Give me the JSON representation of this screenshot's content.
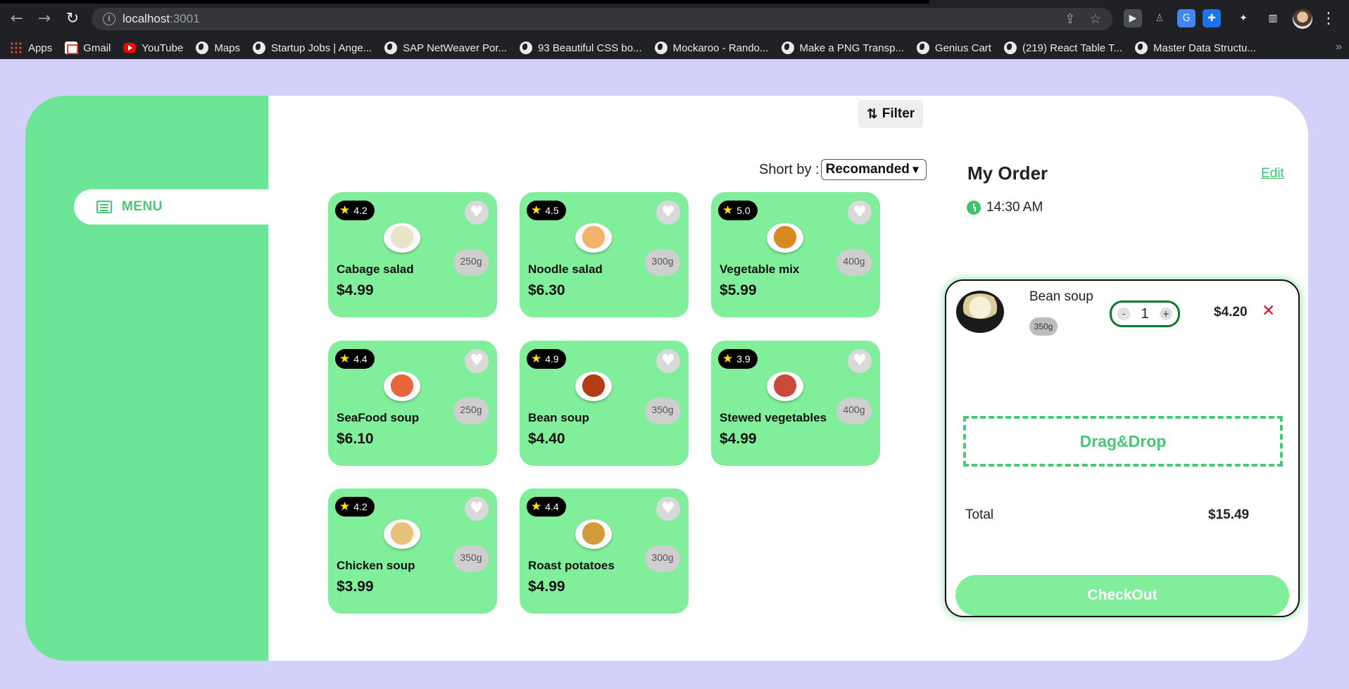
{
  "browser": {
    "url_host": "localhost",
    "url_port": ":3001",
    "bookmarks": [
      {
        "label": "Apps",
        "icon": "apps-grid-icon"
      },
      {
        "label": "Gmail",
        "icon": "gmail-icon"
      },
      {
        "label": "YouTube",
        "icon": "youtube-icon"
      },
      {
        "label": "Maps",
        "icon": "globe-icon"
      },
      {
        "label": "Startup Jobs | Ange...",
        "icon": "globe-icon"
      },
      {
        "label": "SAP NetWeaver Por...",
        "icon": "globe-icon"
      },
      {
        "label": "93 Beautiful CSS bo...",
        "icon": "globe-icon"
      },
      {
        "label": "Mockaroo - Rando...",
        "icon": "globe-icon"
      },
      {
        "label": "Make a PNG Transp...",
        "icon": "globe-icon"
      },
      {
        "label": "Genius Cart",
        "icon": "globe-icon"
      },
      {
        "label": "(219) React Table T...",
        "icon": "globe-icon"
      },
      {
        "label": "Master Data Structu...",
        "icon": "globe-icon"
      }
    ]
  },
  "sidebar": {
    "menu_label": "MENU"
  },
  "toolbar": {
    "filter_label": "Filter",
    "sort_label": "Short by :",
    "sort_value": "Recomanded"
  },
  "menu_items": [
    {
      "name": "Cabage salad",
      "price": "$4.99",
      "rating": "4.2",
      "weight": "250g",
      "food_color": "#e9e3c8"
    },
    {
      "name": "Noodle salad",
      "price": "$6.30",
      "rating": "4.5",
      "weight": "300g",
      "food_color": "#f2b36b"
    },
    {
      "name": "Vegetable mix",
      "price": "$5.99",
      "rating": "5.0",
      "weight": "400g",
      "food_color": "#d98a1f"
    },
    {
      "name": "SeaFood soup",
      "price": "$6.10",
      "rating": "4.4",
      "weight": "250g",
      "food_color": "#e8643a"
    },
    {
      "name": "Bean soup",
      "price": "$4.40",
      "rating": "4.9",
      "weight": "350g",
      "food_color": "#b33c12"
    },
    {
      "name": "Stewed vegetables",
      "price": "$4.99",
      "rating": "3.9",
      "weight": "400g",
      "food_color": "#c94a3a"
    },
    {
      "name": "Chicken soup",
      "price": "$3.99",
      "rating": "4.2",
      "weight": "350g",
      "food_color": "#e7c27a"
    },
    {
      "name": "Roast potatoes",
      "price": "$4.99",
      "rating": "4.4",
      "weight": "300g",
      "food_color": "#d39a3c"
    }
  ],
  "order": {
    "title": "My Order",
    "edit_label": "Edit",
    "time": "14:30 AM",
    "item": {
      "name": "Bean soup",
      "weight": "350g",
      "quantity": "1",
      "price": "$4.20",
      "decrement": "-",
      "increment": "+",
      "remove": "✕"
    },
    "dropzone_label": "Drag&Drop",
    "total_label": "Total",
    "total_value": "$15.49",
    "checkout_label": "CheckOut"
  },
  "colors": {
    "page_bg": "#d3d1fa",
    "sidebar_green": "#6de597",
    "card_green": "#80ee9b",
    "accent_green": "#48c774",
    "remove_red": "#e8112d"
  }
}
